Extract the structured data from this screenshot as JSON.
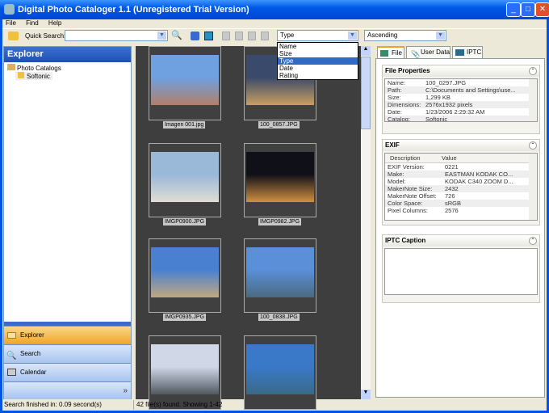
{
  "window": {
    "title": "Digital Photo Cataloger 1.1 (Unregistered Trial Version)"
  },
  "menu": [
    "File",
    "Find",
    "Help"
  ],
  "toolbar": {
    "quick_search_label": "Quick Search:",
    "quick_search_value": "",
    "sort_field": "Type",
    "sort_options": [
      "Name",
      "Size",
      "Type",
      "Date",
      "Rating"
    ],
    "sort_order": "Ascending"
  },
  "explorer": {
    "title": "Explorer",
    "tree": {
      "root": "Photo Catalogs",
      "children": [
        "Softonic"
      ]
    }
  },
  "nav_buttons": [
    "Explorer",
    "Search",
    "Calendar"
  ],
  "gallery": [
    {
      "name": "Imagen 001.jpg",
      "colors": [
        "#6fa0e0",
        "#b0806a"
      ]
    },
    {
      "name": "100_0857.JPG",
      "colors": [
        "#3a4a6a",
        "#c8a060"
      ]
    },
    {
      "name": "IMGP0900.JPG",
      "colors": [
        "#9ab8d8",
        "#e0ddd4"
      ]
    },
    {
      "name": "IMGP0982.JPG",
      "colors": [
        "#101018",
        "#d09040"
      ]
    },
    {
      "name": "IMGP0935.JPG",
      "colors": [
        "#4a80d0",
        "#c0a880"
      ]
    },
    {
      "name": "100_0838.JPG",
      "colors": [
        "#5a90d8",
        "#4a6a80"
      ]
    },
    {
      "name": "",
      "colors": [
        "#d0d8e8",
        "#505860"
      ]
    },
    {
      "name": "",
      "colors": [
        "#3a78c8",
        "#3a6a88"
      ]
    }
  ],
  "right_tabs": [
    "File",
    "User Data",
    "IPTC"
  ],
  "file_properties": {
    "title": "File Properties",
    "rows": [
      [
        "Name:",
        "100_0297.JPG"
      ],
      [
        "Path:",
        "C:\\Documents and Settings\\use..."
      ],
      [
        "Size:",
        "1,299 KB"
      ],
      [
        "Dimensions:",
        "2576x1932 pixels"
      ],
      [
        "Date:",
        "1/23/2006 2:29:32 AM"
      ],
      [
        "Catalog:",
        "Softonic"
      ]
    ]
  },
  "exif": {
    "title": "EXIF",
    "headers": [
      "Description",
      "Value"
    ],
    "rows": [
      [
        "EXIF Version:",
        "0221"
      ],
      [
        "Make:",
        "EASTMAN KODAK CO..."
      ],
      [
        "Model:",
        "KODAK C340 ZOOM D..."
      ],
      [
        "MakerNote Size:",
        "2432"
      ],
      [
        "MakerNote Offset:",
        "726"
      ],
      [
        "Color Space:",
        "sRGB"
      ],
      [
        "Pixel Columns:",
        "2576"
      ]
    ]
  },
  "iptc": {
    "title": "IPTC Caption",
    "value": ""
  },
  "status": {
    "left": "Search finished in: 0.09 second(s)",
    "right": "42 file(s) found. Showing 1-42"
  }
}
